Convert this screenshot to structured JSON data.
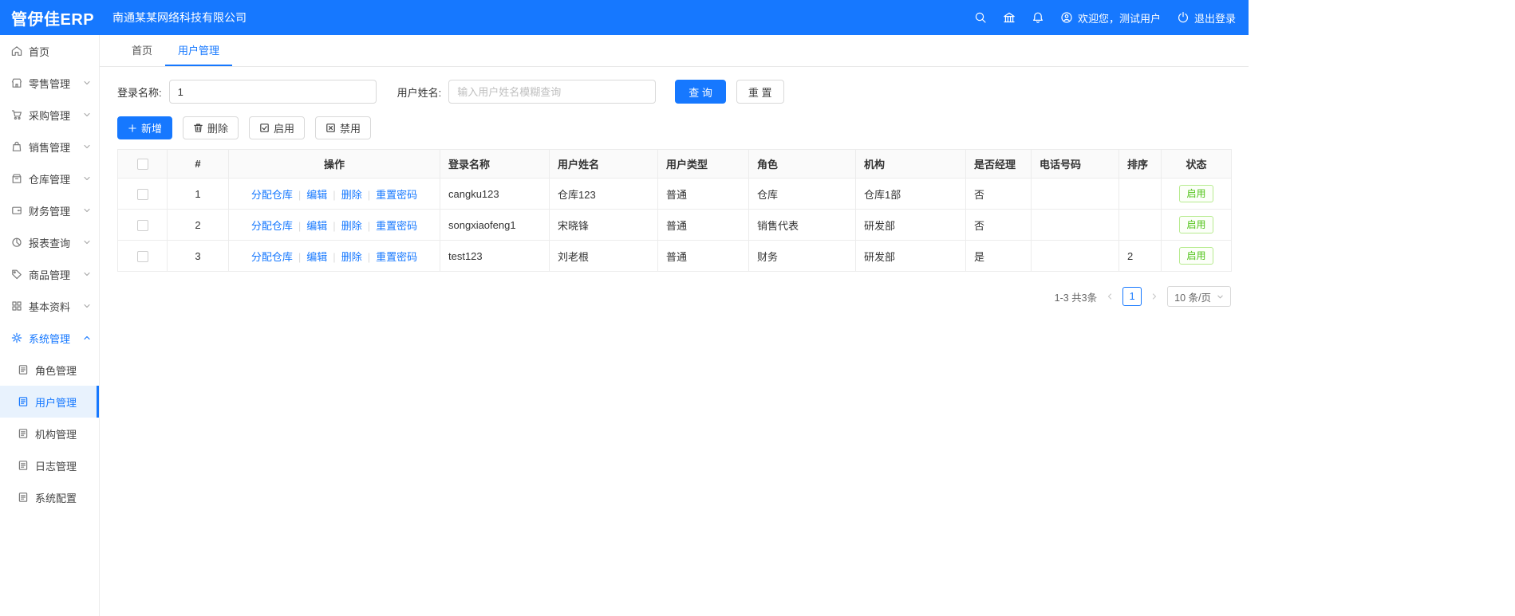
{
  "colors": {
    "primary": "#1678ff",
    "success": "#52c41a"
  },
  "header": {
    "logo": "管伊佳ERP",
    "company": "南通某某网络科技有限公司",
    "welcome": "欢迎您，测试用户",
    "logout": "退出登录"
  },
  "sidebar": {
    "items": [
      {
        "label": "首页"
      },
      {
        "label": "零售管理"
      },
      {
        "label": "采购管理"
      },
      {
        "label": "销售管理"
      },
      {
        "label": "仓库管理"
      },
      {
        "label": "财务管理"
      },
      {
        "label": "报表查询"
      },
      {
        "label": "商品管理"
      },
      {
        "label": "基本资料"
      },
      {
        "label": "系统管理"
      }
    ],
    "subitems": [
      {
        "label": "角色管理"
      },
      {
        "label": "用户管理"
      },
      {
        "label": "机构管理"
      },
      {
        "label": "日志管理"
      },
      {
        "label": "系统配置"
      }
    ]
  },
  "tabs": {
    "home": "首页",
    "user": "用户管理"
  },
  "search": {
    "login_label": "登录名称:",
    "login_value": "1",
    "name_label": "用户姓名:",
    "name_placeholder": "输入用户姓名模糊查询",
    "query_label": "查 询",
    "reset_label": "重 置"
  },
  "toolbar": {
    "add": "新增",
    "delete": "删除",
    "enable": "启用",
    "disable": "禁用"
  },
  "table": {
    "headers": {
      "index": "#",
      "action": "操作",
      "login": "登录名称",
      "name": "用户姓名",
      "type": "用户类型",
      "role": "角色",
      "org": "机构",
      "manager": "是否经理",
      "phone": "电话号码",
      "sort": "排序",
      "status": "状态"
    },
    "actions": {
      "assign": "分配仓库",
      "edit": "编辑",
      "delete": "删除",
      "reset_pwd": "重置密码"
    },
    "rows": [
      {
        "index": "1",
        "login": "cangku123",
        "name": "仓库123",
        "type": "普通",
        "role": "仓库",
        "org": "仓库1部",
        "manager": "否",
        "phone": "",
        "sort": "",
        "status": "启用"
      },
      {
        "index": "2",
        "login": "songxiaofeng1",
        "name": "宋晓锋",
        "type": "普通",
        "role": "销售代表",
        "org": "研发部",
        "manager": "否",
        "phone": "",
        "sort": "",
        "status": "启用"
      },
      {
        "index": "3",
        "login": "test123",
        "name": "刘老根",
        "type": "普通",
        "role": "财务",
        "org": "研发部",
        "manager": "是",
        "phone": "",
        "sort": "2",
        "status": "启用"
      }
    ]
  },
  "pagination": {
    "total": "1-3 共3条",
    "current_page": "1",
    "page_size": "10 条/页"
  }
}
